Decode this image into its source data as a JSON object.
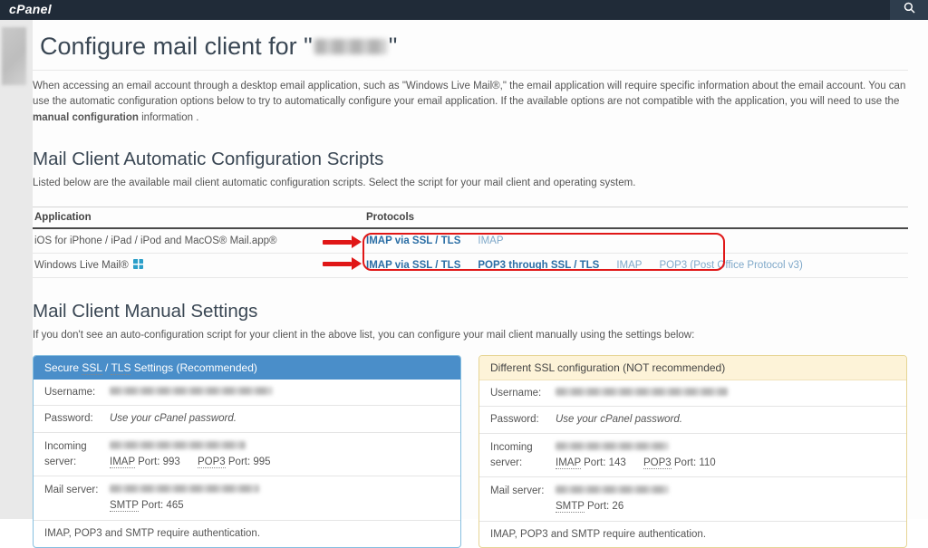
{
  "topbar": {
    "logo_text": "cPanel"
  },
  "page": {
    "title_prefix": "Configure mail client for \"",
    "title_suffix": "\""
  },
  "intro": {
    "text_before_bold": "When accessing an email account through a desktop email application, such as \"Windows Live Mail®,\" the email application will require specific information about the email account. You can use the automatic configuration options below to try to automatically configure your email application. If the available options are not compatible with the application, you will need to use the",
    "bold_text": "manual configuration",
    "text_after_bold": "information ."
  },
  "auto_section": {
    "heading": "Mail Client Automatic Configuration Scripts",
    "subtext": "Listed below are the available mail client automatic configuration scripts. Select the script for your mail client and operating system.",
    "columns": {
      "application": "Application",
      "protocols": "Protocols"
    },
    "rows": [
      {
        "application": "iOS for iPhone / iPad / iPod and MacOS® Mail.app®",
        "protocols": [
          {
            "label": "IMAP via SSL / TLS"
          },
          {
            "label": "IMAP"
          }
        ]
      },
      {
        "application": "Windows Live Mail®",
        "protocols": [
          {
            "label": "IMAP via SSL / TLS"
          },
          {
            "label": "POP3 through SSL / TLS"
          },
          {
            "label": "IMAP"
          },
          {
            "label": "POP3 (Post Office Protocol v3)"
          }
        ]
      }
    ]
  },
  "manual_section": {
    "heading": "Mail Client Manual Settings",
    "subtext": "If you don't see an auto-configuration script for your client in the above list, you can configure your mail client manually using the settings below:",
    "labels": {
      "username": "Username:",
      "password": "Password:",
      "incoming_server": "Incoming server:",
      "mail_server": "Mail server:"
    },
    "secure_box": {
      "title_pre": "Secure",
      "title_abbr_ssl": "SSL",
      "title_sep": "/",
      "title_abbr_tls": "TLS",
      "title_post": "Settings (Recommended)",
      "password_value": "Use your cPanel password.",
      "imap_abbr": "IMAP",
      "imap_port": "Port: 993",
      "pop3_abbr": "POP3",
      "pop3_port": "Port: 995",
      "smtp_abbr": "SMTP",
      "smtp_port": "Port: 465",
      "footer": "IMAP, POP3 and SMTP require authentication."
    },
    "nonssl_box": {
      "title": "Different SSL configuration (NOT recommended)",
      "password_value": "Use your cPanel password.",
      "imap_abbr": "IMAP",
      "imap_port": "Port: 143",
      "pop3_abbr": "POP3",
      "pop3_port": "Port: 110",
      "smtp_abbr": "SMTP",
      "smtp_port": "Port: 26",
      "footer": "IMAP, POP3 and SMTP require authentication."
    }
  },
  "colors": {
    "topbar_bg": "#202b38",
    "accent_blue": "#4a8ec9",
    "link_strong": "#2b6ea5",
    "link_light": "#7fa8c9",
    "highlight_red": "#e01717",
    "warning_bg": "#fdf3d8",
    "warning_border": "#e6d595"
  }
}
